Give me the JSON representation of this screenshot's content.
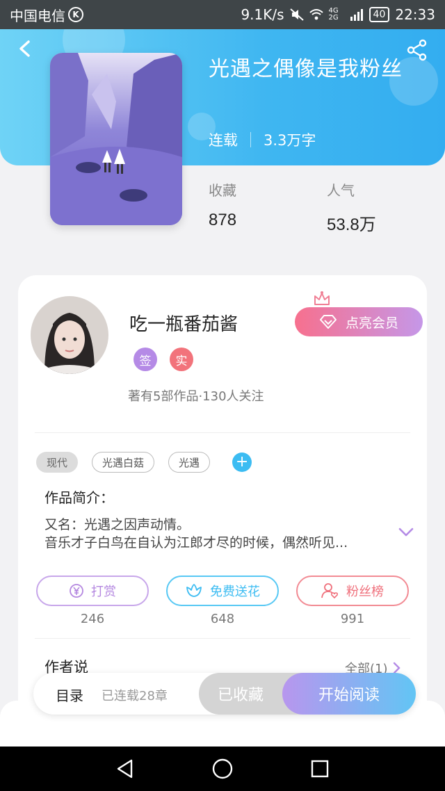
{
  "status_bar": {
    "carrier": "中国电信",
    "carrier_badge": "K",
    "net_speed": "9.1K/s",
    "network": "4G 2G",
    "battery": "40",
    "time": "22:33"
  },
  "book": {
    "title": "光遇之偶像是我粉丝",
    "status": "连载",
    "word_count": "3.3万字",
    "favorites_label": "收藏",
    "favorites_value": "878",
    "popularity_label": "人气",
    "popularity_value": "53.8万"
  },
  "author": {
    "name": "吃一瓶番茄酱",
    "badge_sign": "签",
    "badge_real": "实",
    "info": "著有5部作品·130人关注",
    "vip_label": "点亮会员"
  },
  "tags": [
    {
      "label": "现代"
    },
    {
      "label": "光遇白菇"
    },
    {
      "label": "光遇"
    }
  ],
  "intro": {
    "title": "作品简介：",
    "line1": "又名：光遇之因声动情。",
    "line2": "音乐才子白鸟在自认为江郎才尽的时候，偶然听见..."
  },
  "actions": [
    {
      "label": "打赏",
      "count": "246",
      "color": "#b487e0"
    },
    {
      "label": "免费送花",
      "count": "648",
      "color": "#3cbcf2"
    },
    {
      "label": "粉丝榜",
      "count": "991",
      "color": "#ef6f7b"
    }
  ],
  "author_say": {
    "title": "作者说",
    "all_label": "全部(1)"
  },
  "bottom_bar": {
    "toc_label": "目录",
    "chapters_label": "已连载28章",
    "collected_label": "已收藏",
    "read_label": "开始阅读"
  },
  "colors": {
    "header": "#3fb6f1",
    "accent_blue": "#3cbcf2",
    "vip_pink": "#f7708e",
    "vip_purple": "#c597e8"
  }
}
